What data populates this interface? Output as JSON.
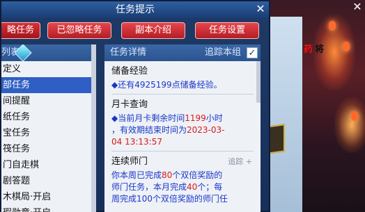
{
  "dialog": {
    "title": "任务提示",
    "close": "✕"
  },
  "toolbar": {
    "buttons": [
      "略任务",
      "已忽略任务",
      "副本介绍",
      "任务设置"
    ]
  },
  "left_list": {
    "header": "列表",
    "items": [
      "定义",
      "部任务",
      "间提醒",
      "纸任务",
      "宝任务",
      "筏任务",
      "门自走棋",
      "剧答题",
      "木棋局·开启",
      "瑕勋章·开启"
    ]
  },
  "detail": {
    "header": "任务详情",
    "track_label": "追踪本组",
    "checkbox": "✓",
    "sections": [
      {
        "title": "储备经验",
        "line1": "◆还有4925199点储备经验。"
      },
      {
        "title": "月卡查询",
        "l1a": "◆当前月卡剩余时间",
        "l1b": "1199",
        "l1c": "小时",
        "l2a": "，有效期结束时间为",
        "l2b": "2023-03-",
        "l3": "04 13:13:57"
      },
      {
        "title": "连续师门",
        "track": "追踪 +",
        "l1a": "你本周已完成",
        "l1b": "80",
        "l1c": "个双倍奖励的",
        "l2a": "师门任务，本月完成",
        "l2b": "40",
        "l2c": "个；每",
        "l3": "周完成100个双倍奖励的师门任"
      }
    ]
  },
  "scene": {
    "text_red": "药",
    "text_black": "将",
    "close": "✕"
  },
  "colors": {
    "accent": "#2f5fc4",
    "button": "#c4252c",
    "link_blue": "#1a36c9",
    "highlight_red": "#d81a1a"
  }
}
